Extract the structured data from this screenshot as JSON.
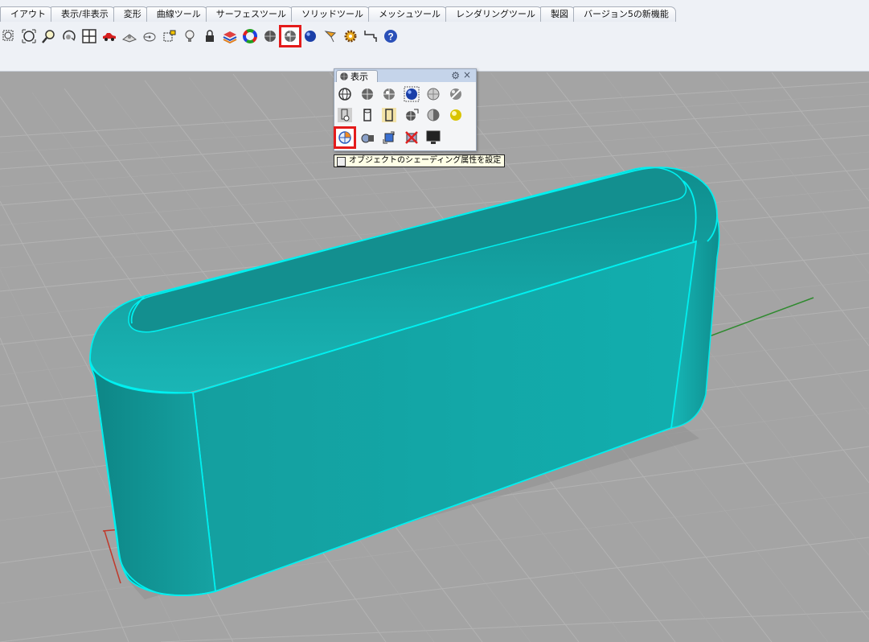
{
  "tabs": [
    "イアウト",
    "表示/非表示",
    "変形",
    "曲線ツール",
    "サーフェスツール",
    "ソリッドツール",
    "メッシュツール",
    "レンダリングツール",
    "製図",
    "バージョン5の新機能"
  ],
  "toolbar": {
    "icons": [
      "zoom-window-icon",
      "zoom-extents-icon",
      "zoom-selected-icon",
      "rotate-view-icon",
      "viewport-layout-icon",
      "car-icon",
      "properties-icon",
      "hide-icon",
      "select-points-icon",
      "light-icon",
      "lock-icon",
      "layer-icon",
      "color-wheel-icon",
      "shaded-sphere-icon",
      "rendered-sphere-icon",
      "blue-sphere-icon",
      "flag-icon",
      "gear-settings-icon",
      "dimension-icon",
      "help-icon"
    ],
    "highlighted": "rendered-sphere-icon"
  },
  "panel": {
    "title": "表示",
    "row1": [
      "wireframe-icon",
      "shaded-icon",
      "rendered-icon",
      "blue-render-icon",
      "ghosted-icon",
      "xray-icon"
    ],
    "row2": [
      "technical-icon",
      "artistic-icon",
      "pen-icon",
      "world-sphere-icon",
      "half-shaded-icon",
      "gold-sphere-icon"
    ],
    "row3": [
      "object-shading-icon",
      "camera-icon",
      "capture-icon",
      "disable-icon",
      "monitor-icon"
    ],
    "highlighted": "object-shading-icon"
  },
  "tooltip": "オブジェクトのシェーディング属性を設定",
  "colors": {
    "object": "#12a8a8",
    "edge": "#00f0f0",
    "grid_minor": "#b4b4b4",
    "grid_major": "#888888",
    "axis_x": "#c0392b",
    "axis_y": "#2f8a2f"
  }
}
